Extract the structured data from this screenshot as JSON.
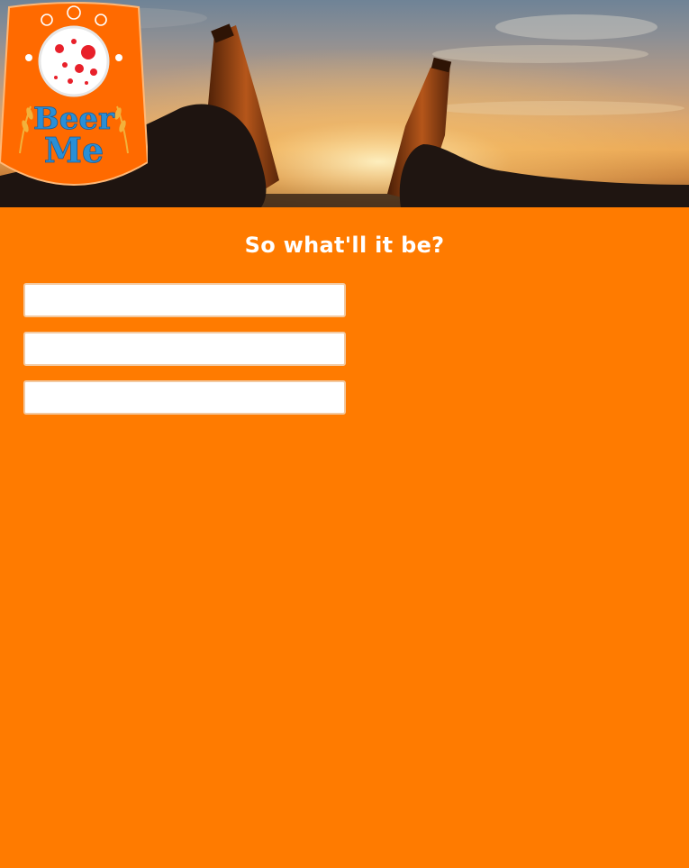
{
  "brand": {
    "logo_text_line1": "Beer",
    "logo_text_line2": "Me"
  },
  "form": {
    "heading": "So what'll it be?",
    "fields": [
      {
        "value": "",
        "placeholder": ""
      },
      {
        "value": "",
        "placeholder": ""
      },
      {
        "value": "",
        "placeholder": ""
      }
    ]
  },
  "colors": {
    "page_background": "#ff7b00",
    "logo_badge": "#ff6a00",
    "logo_text": "#2a8fd6",
    "logo_dots": "#e8202a"
  }
}
